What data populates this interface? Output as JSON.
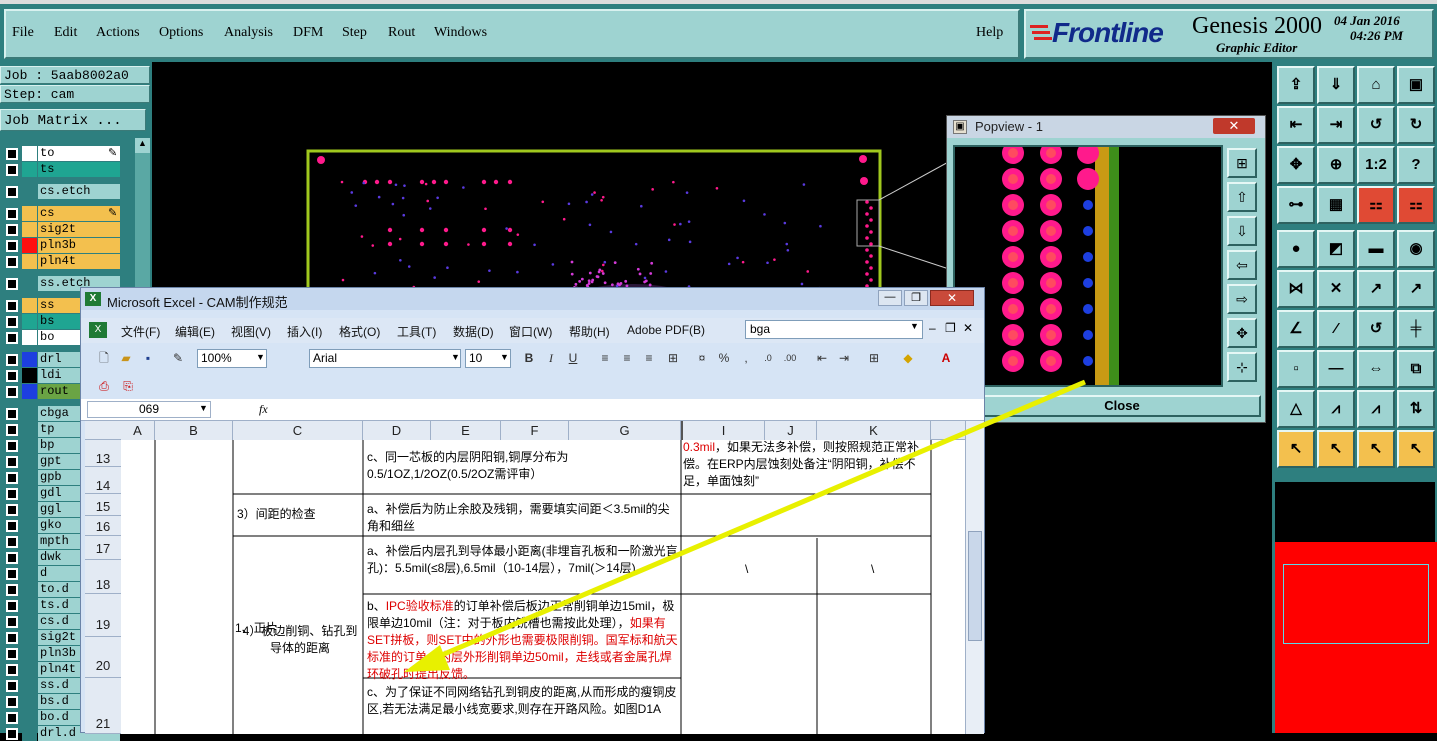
{
  "menu": {
    "items": [
      "File",
      "Edit",
      "Actions",
      "Options",
      "Analysis",
      "DFM",
      "Step",
      "Rout",
      "Windows"
    ],
    "help": "Help"
  },
  "brand": {
    "logo": "Frontline",
    "product": "Genesis 2000",
    "subtitle": "Graphic Editor",
    "date": "04 Jan 2016",
    "time": "04:26 PM"
  },
  "job": {
    "job_label": "Job : 5aab8002a0",
    "step_label": "Step: cam",
    "matrix_button": "Job Matrix ..."
  },
  "layers": [
    {
      "name": "to",
      "color": "#ffffff",
      "bg": "#ffffff",
      "edit": true
    },
    {
      "name": "ts",
      "color": "#1fa592",
      "bg": "#1fa592"
    },
    {
      "name": "cs.etch",
      "color": "",
      "bg": "#9ed3d1"
    },
    {
      "name": "cs",
      "color": "#f3c04e",
      "bg": "#f3c04e",
      "edit": true
    },
    {
      "name": "sig2t",
      "color": "#f3c04e",
      "bg": "#f3c04e"
    },
    {
      "name": "pln3b",
      "color": "#ff1010",
      "bg": "#f3c04e"
    },
    {
      "name": "pln4t",
      "color": "#f3c04e",
      "bg": "#f3c04e"
    },
    {
      "name": "ss.etch",
      "color": "",
      "bg": "#9ed3d1"
    },
    {
      "name": "ss",
      "color": "#f3c04e",
      "bg": "#f3c04e"
    },
    {
      "name": "bs",
      "color": "#1fa592",
      "bg": "#1fa592"
    },
    {
      "name": "bo",
      "color": "#ffffff",
      "bg": "#ffffff"
    },
    {
      "name": "drl",
      "color": "#1d3fe0",
      "bg": "#9ed3d1"
    },
    {
      "name": "ldi",
      "color": "#000000",
      "bg": "#9ed3d1"
    },
    {
      "name": "rout",
      "color": "#1d3fe0",
      "bg": "#6aa444"
    },
    {
      "name": "cbga",
      "color": "",
      "bg": "#9ed3d1"
    },
    {
      "name": "tp",
      "color": "",
      "bg": "#9ed3d1"
    },
    {
      "name": "bp",
      "color": "",
      "bg": "#9ed3d1"
    },
    {
      "name": "gpt",
      "color": "",
      "bg": "#9ed3d1"
    },
    {
      "name": "gpb",
      "color": "",
      "bg": "#9ed3d1"
    },
    {
      "name": "gdl",
      "color": "",
      "bg": "#9ed3d1"
    },
    {
      "name": "ggl",
      "color": "",
      "bg": "#9ed3d1"
    },
    {
      "name": "gko",
      "color": "",
      "bg": "#9ed3d1"
    },
    {
      "name": "mpth",
      "color": "",
      "bg": "#9ed3d1"
    },
    {
      "name": "dwk",
      "color": "",
      "bg": "#9ed3d1"
    },
    {
      "name": "d",
      "color": "",
      "bg": "#9ed3d1"
    },
    {
      "name": "to.d",
      "color": "",
      "bg": "#9ed3d1"
    },
    {
      "name": "ts.d",
      "color": "",
      "bg": "#9ed3d1"
    },
    {
      "name": "cs.d",
      "color": "",
      "bg": "#9ed3d1"
    },
    {
      "name": "sig2t",
      "color": "",
      "bg": "#9ed3d1"
    },
    {
      "name": "pln3b",
      "color": "",
      "bg": "#9ed3d1"
    },
    {
      "name": "pln4t",
      "color": "",
      "bg": "#9ed3d1"
    },
    {
      "name": "ss.d",
      "color": "",
      "bg": "#9ed3d1"
    },
    {
      "name": "bs.d",
      "color": "",
      "bg": "#9ed3d1"
    },
    {
      "name": "bo.d",
      "color": "",
      "bg": "#9ed3d1"
    },
    {
      "name": "drl.d",
      "color": "",
      "bg": "#9ed3d1"
    }
  ],
  "popview": {
    "title": "Popview - 1",
    "close_button": "Close"
  },
  "excel": {
    "title": "Microsoft Excel - CAM制作规范",
    "menu": [
      "文件(F)",
      "编辑(E)",
      "视图(V)",
      "插入(I)",
      "格式(O)",
      "工具(T)",
      "数据(D)",
      "窗口(W)",
      "帮助(H)",
      "Adobe PDF(B)"
    ],
    "help_search": "bga",
    "zoom": "100%",
    "font": "Arial",
    "font_size": "10",
    "name_box": "069",
    "fx": "fx",
    "columns": [
      "A",
      "B",
      "C",
      "D",
      "E",
      "F",
      "G",
      "I",
      "J",
      "K"
    ],
    "rows": [
      "13",
      "14",
      "15",
      "16",
      "17",
      "18",
      "19",
      "20",
      "21"
    ],
    "cells": {
      "b_main": "1、正片",
      "c_15": "3）间距的检查",
      "c_19": "4）板边削铜、钻孔到导体的距离",
      "d_13": "c、同一芯板的内层阴阳铜,铜厚分布为0.5/1OZ,1/2OZ(0.5/2OZ需评审）",
      "d_15": "a、补偿后为防止余胶及残铜，需要填实间距＜3.5mil的尖角和细丝",
      "d_17": "a、补偿后内层孔到导体最小距离(非埋盲孔板和一阶激光盲孔)：5.5mil(≤8层),6.5mil（10-14层），7mil(＞14层)。",
      "d_19_a": "b、",
      "d_19_red1": "IPC验收标准",
      "d_19_b": "的订单补偿后板边正常削铜单边15mil，极限单边10mil（注：对于板内铣槽也需按此处理），",
      "d_19_red2": "如果有SET拼板，则SET中的外形也需要极限削铜。国军标和航天标准的订单，内层外形削铜单边50mil，",
      "d_19_c": "走线或者金属孔焊环破孔时提出反馈。",
      "d_21": "c、为了保证不同网络钻孔到铜皮的距离,从而形成的瘦铜皮区,若无法满足最小线宽要求,则存在开路风险。如图D1A",
      "i_13_red": "0.3mil",
      "i_13": "，如果无法多补偿，则按照规范正常补偿。在ERP内层蚀刻处备注“阴阳铜，补偿不足，单面蚀刻”",
      "i_18": "\\",
      "k_18": "\\"
    }
  },
  "colors": {
    "panel_bg": "#9ed3d1",
    "frame": "#2e7f7f",
    "pad": "#ff1a8c",
    "board_outline": "#a0c81e",
    "arrow": "#e8f000"
  }
}
